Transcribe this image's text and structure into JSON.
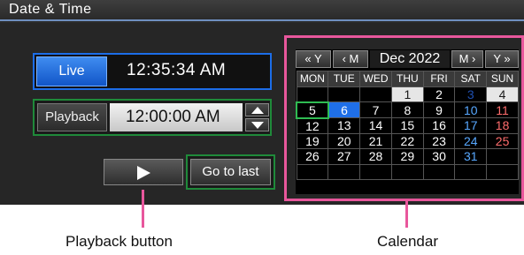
{
  "window": {
    "title": "Date & Time"
  },
  "live": {
    "button_label": "Live",
    "time": "12:35:34 AM"
  },
  "playback": {
    "label": "Playback",
    "time": "12:00:00 AM"
  },
  "controls": {
    "go_to_last": "Go to last"
  },
  "calendar": {
    "nav": {
      "prev_year": "« Y",
      "prev_month": "‹ M",
      "month_year": "Dec 2022",
      "next_month": "M ›",
      "next_year": "Y »"
    },
    "weekdays": [
      "MON",
      "TUE",
      "WED",
      "THU",
      "FRI",
      "SAT",
      "SUN"
    ],
    "weeks": [
      [
        "",
        "",
        "",
        "1",
        "2",
        "3",
        "4"
      ],
      [
        "5",
        "6",
        "7",
        "8",
        "9",
        "10",
        "11"
      ],
      [
        "12",
        "13",
        "14",
        "15",
        "16",
        "17",
        "18"
      ],
      [
        "19",
        "20",
        "21",
        "22",
        "23",
        "24",
        "25"
      ],
      [
        "26",
        "27",
        "28",
        "29",
        "30",
        "31",
        ""
      ],
      [
        "",
        "",
        "",
        "",
        "",
        "",
        ""
      ]
    ],
    "today": "5",
    "selected": "6"
  },
  "annotations": {
    "playback_button": "Playback button",
    "calendar": "Calendar"
  },
  "colors": {
    "accent_blue": "#1f6fe8",
    "frame_green": "#1f8a3a",
    "callout_pink": "#e8579c",
    "saturday": "#58a8ff",
    "sunday": "#ff6d6d"
  }
}
